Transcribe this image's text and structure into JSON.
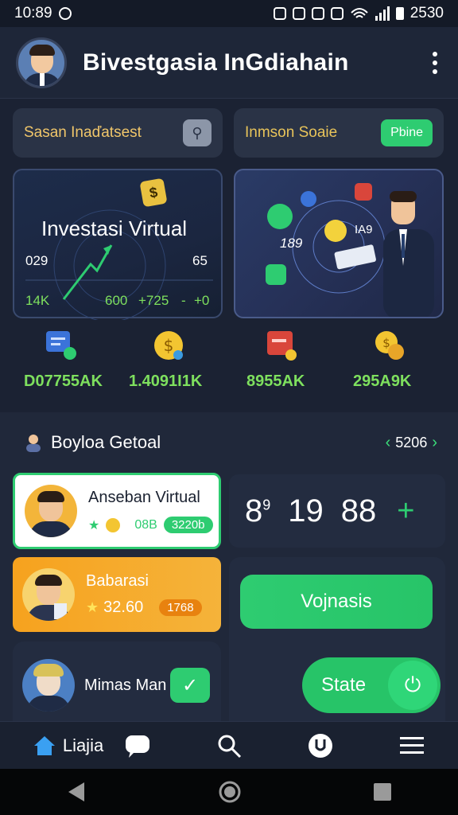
{
  "status_bar": {
    "time": "10:89",
    "battery": "2530"
  },
  "header": {
    "title": "Bivestgasia InGdiahain"
  },
  "top_cards": {
    "left_label": "Sasan Inaďatsest",
    "right_label": "Inmson Soaie",
    "right_button": "Pbine"
  },
  "panel_left": {
    "badge": "$",
    "title": "Investasi Virtual",
    "val_a": "029",
    "val_b": "65",
    "row_a": "14K",
    "row_b": "600",
    "row_c": "+725",
    "row_d": "-",
    "row_e": "+0"
  },
  "panel_right": {
    "val_a": "189",
    "val_b": "IA9"
  },
  "stats": [
    {
      "label": "D07755AK"
    },
    {
      "label": "1.4091I1K"
    },
    {
      "label": "8955AK"
    },
    {
      "label": "295A9K"
    }
  ],
  "section": {
    "title": "Boyloa Getoal",
    "pager_value": "5206"
  },
  "list": [
    {
      "name": "Anseban Virtual",
      "score": "08B",
      "tag": "3220b"
    },
    {
      "name": "Babarasi",
      "score": "32.60",
      "tag": "1768"
    },
    {
      "name": "Mimas Man"
    }
  ],
  "scoreboard": {
    "a": "8",
    "a_sup": "9",
    "b": "19",
    "c": "88",
    "plus": "+"
  },
  "buttons": {
    "primary": "Vojnasis",
    "state": "State"
  },
  "bottom_nav": {
    "home_label": "Liajia"
  },
  "colors": {
    "accent_green": "#2ecc71",
    "accent_orange": "#f39c12",
    "background": "#1b2233"
  }
}
